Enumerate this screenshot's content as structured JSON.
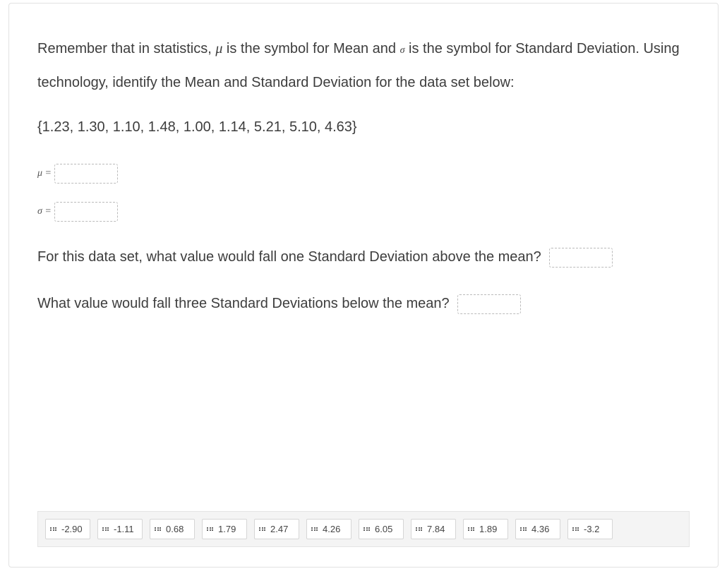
{
  "prompt": {
    "part1": "Remember that in statistics, ",
    "mu": "μ",
    "part2": " is the symbol for Mean and ",
    "sigma": "σ",
    "part3": " is the symbol for Standard Deviation.  Using technology, identify the Mean and Standard Deviation for the data set below:"
  },
  "data_set": "{1.23, 1.30, 1.10, 1.48, 1.00, 1.14, 5.21, 5.10, 4.63}",
  "equations": {
    "mu_label": "μ =",
    "sigma_label": "σ ="
  },
  "questions": {
    "q1_part1": "For this data set, what value would fall one Standard Deviation above the mean?",
    "q2": "What value would fall three Standard Deviations below the mean?"
  },
  "answer_bank": [
    "-2.90",
    "-1.11",
    "0.68",
    "1.79",
    "2.47",
    "4.26",
    "6.05",
    "7.84",
    "1.89",
    "4.36",
    "-3.2"
  ]
}
